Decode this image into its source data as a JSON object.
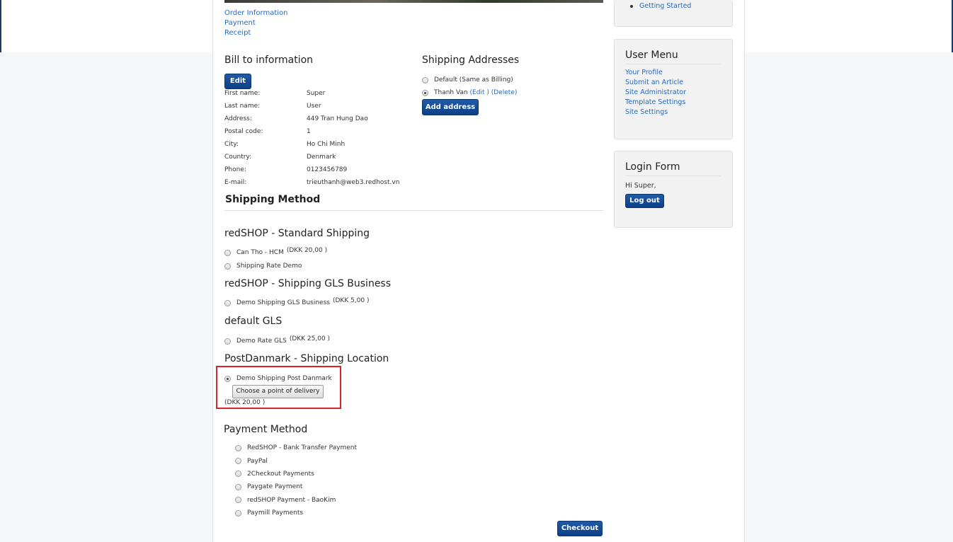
{
  "checkout_steps": [
    "Order Information",
    "Payment",
    "Receipt"
  ],
  "bill_to": {
    "title": "Bill to information",
    "edit_label": "Edit",
    "rows": [
      {
        "label": "First name:",
        "value": "Super"
      },
      {
        "label": "Last name:",
        "value": "User"
      },
      {
        "label": "Address:",
        "value": "449 Tran Hung Dao"
      },
      {
        "label": "Postal code:",
        "value": "1"
      },
      {
        "label": "City:",
        "value": "Ho Chi Minh"
      },
      {
        "label": "Country:",
        "value": "Denmark"
      },
      {
        "label": "Phone:",
        "value": "0123456789"
      },
      {
        "label": "E-mail:",
        "value": "trieuthanh@web3.redhost.vn"
      }
    ]
  },
  "shipping_addresses": {
    "title": "Shipping Addresses",
    "default_label": "Default (Same as Billing)",
    "address_name": "Thanh Van",
    "edit_link": "(Edit )",
    "delete_link": "(Delete)",
    "add_label": "Add address"
  },
  "shipping_method": {
    "title": "Shipping Method",
    "groups": [
      {
        "title": "redSHOP - Standard Shipping",
        "options": [
          {
            "label": "Can Tho - HCM",
            "price": "(DKK 20,00 )"
          },
          {
            "label": "Shipping Rate Demo",
            "price": ""
          }
        ]
      },
      {
        "title": "redSHOP - Shipping GLS Business",
        "options": [
          {
            "label": "Demo Shipping GLS Business",
            "price": "(DKK 5,00 )"
          }
        ]
      },
      {
        "title": "default GLS",
        "options": [
          {
            "label": "Demo Rate GLS",
            "price": "(DKK 25,00 )"
          }
        ]
      },
      {
        "title": "PostDanmark - Shipping Location",
        "options": [
          {
            "label": "Demo Shipping Post Danmark",
            "price": "(DKK 20,00 )",
            "button": "Choose a point of delivery"
          }
        ]
      }
    ]
  },
  "payment_method": {
    "title": "Payment Method",
    "options": [
      "RedSHOP - Bank Transfer Payment",
      "PayPal",
      "2Checkout Payments",
      "Paygate Payment",
      "redSHOP Payment - BaoKim",
      "Paymill Payments"
    ]
  },
  "checkout_label": "Checkout",
  "sidebar": {
    "top_link": "Getting Started",
    "user_menu": {
      "title": "User Menu",
      "items": [
        "Your Profile",
        "Submit an Article",
        "Site Administrator",
        "Template Settings",
        "Site Settings"
      ]
    },
    "login_form": {
      "title": "Login Form",
      "greeting": "Hi Super,",
      "logout_label": "Log out"
    }
  },
  "colors": {
    "link": "#2a69b8",
    "primary_button": "#0d3f85",
    "highlight_border": "#d9232a"
  }
}
